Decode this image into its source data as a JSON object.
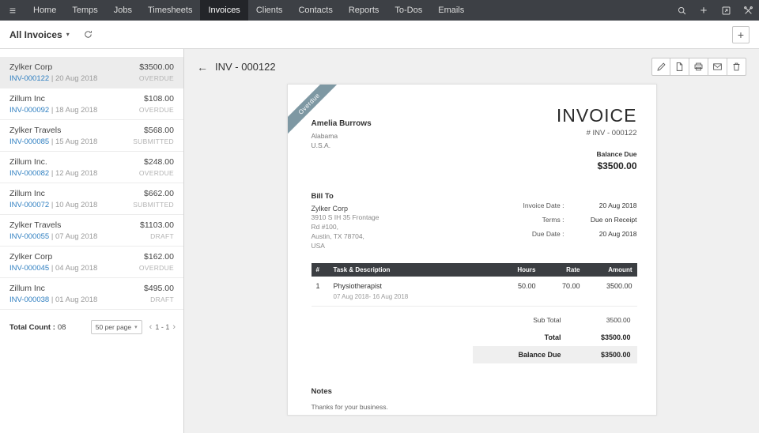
{
  "colors": {
    "nav_bg": "#3d4045",
    "nav_active_bg": "#232529",
    "link_blue": "#2f7fc1",
    "table_header_bg": "#3b3e42",
    "ribbon_bg": "#7e98a3",
    "highlight_row_bg": "#efefef"
  },
  "topnav": {
    "menu_icon": "≡",
    "plus_icon": "+",
    "items": [
      "Home",
      "Temps",
      "Jobs",
      "Timesheets",
      "Invoices",
      "Clients",
      "Contacts",
      "Reports",
      "To-Dos",
      "Emails"
    ],
    "active_item": "Invoices"
  },
  "toolbar": {
    "filter_label": "All Invoices",
    "caret_icon": "▾",
    "add_label": "+"
  },
  "sidebar": {
    "separator": "|",
    "invoices": [
      {
        "company": "Zylker Corp",
        "number": "INV-000122",
        "date": "20 Aug 2018",
        "amount": "$3500.00",
        "status": "OVERDUE"
      },
      {
        "company": "Zillum Inc",
        "number": "INV-000092",
        "date": "18 Aug 2018",
        "amount": "$108.00",
        "status": "OVERDUE"
      },
      {
        "company": "Zylker Travels",
        "number": "INV-000085",
        "date": "15 Aug 2018",
        "amount": "$568.00",
        "status": "SUBMITTED"
      },
      {
        "company": "Zillum Inc.",
        "number": "INV-000082",
        "date": "12 Aug 2018",
        "amount": "$248.00",
        "status": "OVERDUE"
      },
      {
        "company": "Zillum Inc",
        "number": "INV-000072",
        "date": "10 Aug 2018",
        "amount": "$662.00",
        "status": "SUBMITTED"
      },
      {
        "company": "Zylker Travels",
        "number": "INV-000055",
        "date": "07 Aug 2018",
        "amount": "$1103.00",
        "status": "DRAFT"
      },
      {
        "company": "Zylker Corp",
        "number": "INV-000045",
        "date": "04 Aug 2018",
        "amount": "$162.00",
        "status": "OVERDUE"
      },
      {
        "company": "Zillum Inc",
        "number": "INV-000038",
        "date": "01 Aug 2018",
        "amount": "$495.00",
        "status": "DRAFT"
      }
    ],
    "footer": {
      "total_count_label": "Total Count :",
      "total_count": "08",
      "per_page_value": "50 per page",
      "select_caret": "▾",
      "prev_icon": "‹",
      "page_range": "1 - 1",
      "next_icon": "›"
    }
  },
  "main": {
    "back_icon": "←",
    "title": "INV - 000122",
    "invoice": {
      "ribbon_label": "Overdue",
      "sender": {
        "name": "Amelia Burrows",
        "line1": "Alabama",
        "line2": "U.S.A."
      },
      "doc_title": "INVOICE",
      "doc_number": "# INV - 000122",
      "balance_due_label": "Balance Due",
      "balance_due_amount": "$3500.00",
      "bill_to_label": "Bill To",
      "customer": {
        "name": "Zylker Corp",
        "line1": "3910 S IH 35 Frontage",
        "line2": "Rd #100,",
        "line3": "Austin, TX 78704,",
        "line4": "USA"
      },
      "meta": [
        {
          "label": "Invoice Date :",
          "value": "20 Aug 2018"
        },
        {
          "label": "Terms :",
          "value": "Due on Receipt"
        },
        {
          "label": "Due Date :",
          "value": "20 Aug 2018"
        }
      ],
      "table": {
        "headers": {
          "num": "#",
          "task": "Task & Description",
          "hours": "Hours",
          "rate": "Rate",
          "amount": "Amount"
        },
        "rows": [
          {
            "num": "1",
            "task": "Physiotherapist",
            "period": "07 Aug 2018- 16 Aug 2018",
            "hours": "50.00",
            "rate": "70.00",
            "amount": "3500.00"
          }
        ]
      },
      "summary": {
        "subtotal_label": "Sub Total",
        "subtotal": "3500.00",
        "total_label": "Total",
        "total": "$3500.00",
        "balance_label": "Balance Due",
        "balance": "$3500.00"
      },
      "notes_label": "Notes",
      "notes": "Thanks for your business."
    }
  }
}
